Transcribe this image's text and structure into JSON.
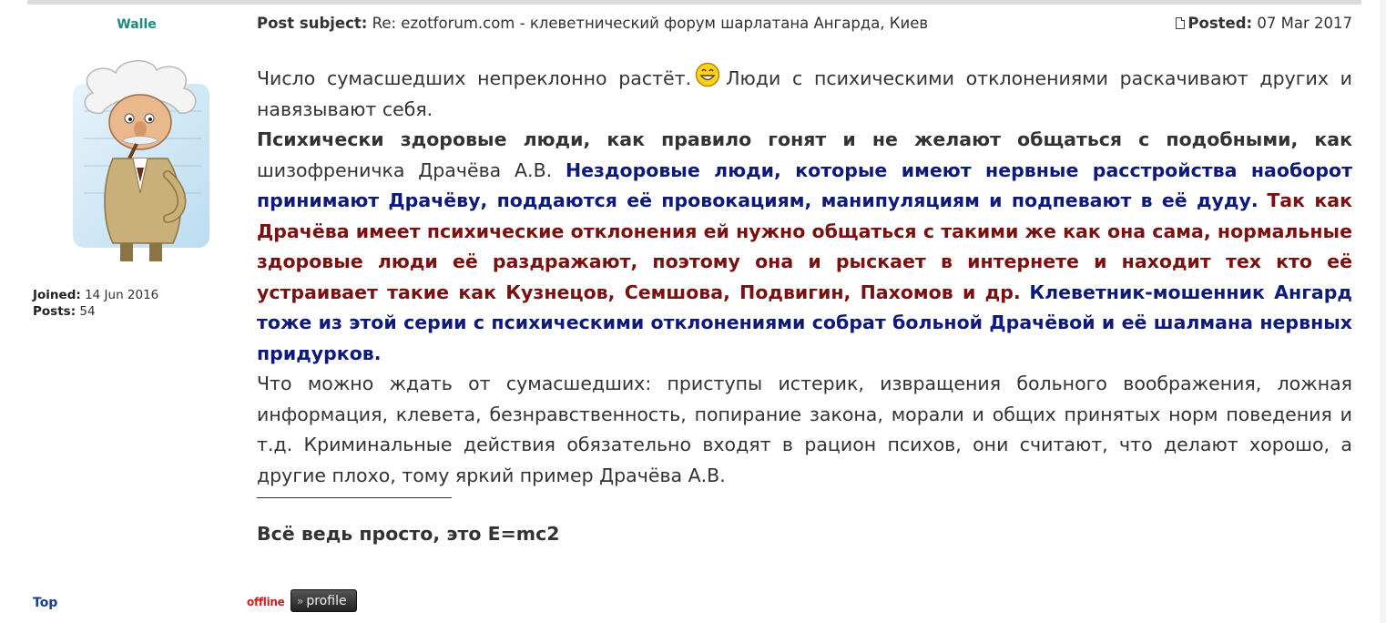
{
  "author": {
    "name": "Walle",
    "joined_label": "Joined:",
    "joined_value": "14 Jun 2016",
    "posts_label": "Posts:",
    "posts_value": "54",
    "top_link": "Top"
  },
  "post": {
    "subject_label": "Post subject:",
    "subject_text": "Re: ezotforum.com - клеветнический форум шарлатана Ангарда, Киев",
    "posted_label": "Posted:",
    "posted_date": "07 Mar 2017",
    "body": {
      "p1_a": "Число сумасшедших непреклонно растёт.",
      "p1_b": "Люди с психическими отклонениями раскачивают других и навязывают себя.",
      "p2_bold": "Психически здоровые люди, как правило гонят и не желают общаться с подобными, как",
      "p2_plain": "шизофреничка Драчёва А.В.",
      "p2_navy": "Нездоровые люди, которые имеют нервные расстройства наоборот принимают Драчёву, поддаются её провокациям, манипуляциям и подпевают в её дуду.",
      "p2_maroon": "Так как Драчёва имеет психические отклонения ей нужно общаться с такими же как она сама, нормальные здоровые люди её раздражают, поэтому она и рыскает в интернете и находит тех кто её устраивает такие как Кузнецов, Семшова, Подвигин, Пахомов и др.",
      "p2_navy2": "Клеветник-мошенник Ангард тоже из этой серии с психическими отклонениями собрат больной Драчёвой и её шалмана нервных придурков.",
      "p3": "Что можно ждать от сумасшедших: приступы истерик, извращения больного воображения, ложная информация, клевета, безнравственность, попирание закона, морали и общих принятых норм поведения и т.д. Криминальные действия обязательно входят в рацион психов, они считают, что делают хорошо, а другие плохо, тому яркий пример Драчёва А.В."
    },
    "signature": "Всё ведь просто, это E=mc2"
  },
  "footer": {
    "status": "offline",
    "profile_label": "profile"
  },
  "colors": {
    "username": "#1b8a7e",
    "navy_text": "#0d1a7a",
    "maroon_text": "#7a1010",
    "offline": "#cc1f1f",
    "link": "#1a3d8f"
  },
  "icons": {
    "post": "post-icon",
    "smiley": "smiley-icon",
    "avatar": "scientist-avatar",
    "profile_chevron": "double-chevron-icon"
  }
}
